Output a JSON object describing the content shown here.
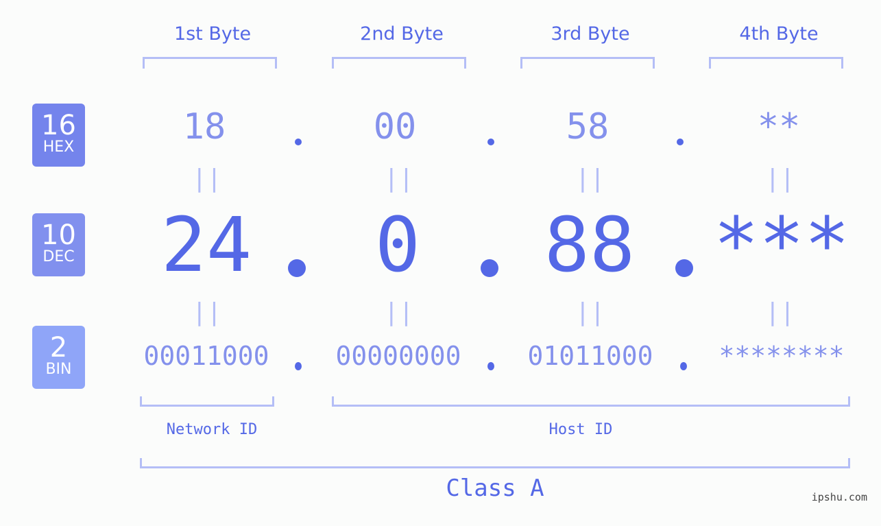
{
  "bytes": [
    {
      "header": "1st Byte",
      "hex": "18",
      "dec": "24",
      "bin": "00011000"
    },
    {
      "header": "2nd Byte",
      "hex": "00",
      "dec": "0",
      "bin": "00000000"
    },
    {
      "header": "3rd Byte",
      "hex": "58",
      "dec": "88",
      "bin": "01011000"
    },
    {
      "header": "4th Byte",
      "hex": "**",
      "dec": "***",
      "bin": "********"
    }
  ],
  "badges": {
    "hex": {
      "num": "16",
      "label": "HEX",
      "color": "#7484ec"
    },
    "dec": {
      "num": "10",
      "label": "DEC",
      "color": "#8190ee"
    },
    "bin": {
      "num": "2",
      "label": "BIN",
      "color": "#8fa5f8"
    }
  },
  "equals_glyph": "||",
  "network_id_label": "Network ID",
  "host_id_label": "Host ID",
  "class_label": "Class A",
  "watermark": "ipshu.com",
  "colors": {
    "primary": "#5468e6",
    "light": "#8491ec",
    "bracket": "#b4bef6",
    "background": "#fbfcfb"
  }
}
